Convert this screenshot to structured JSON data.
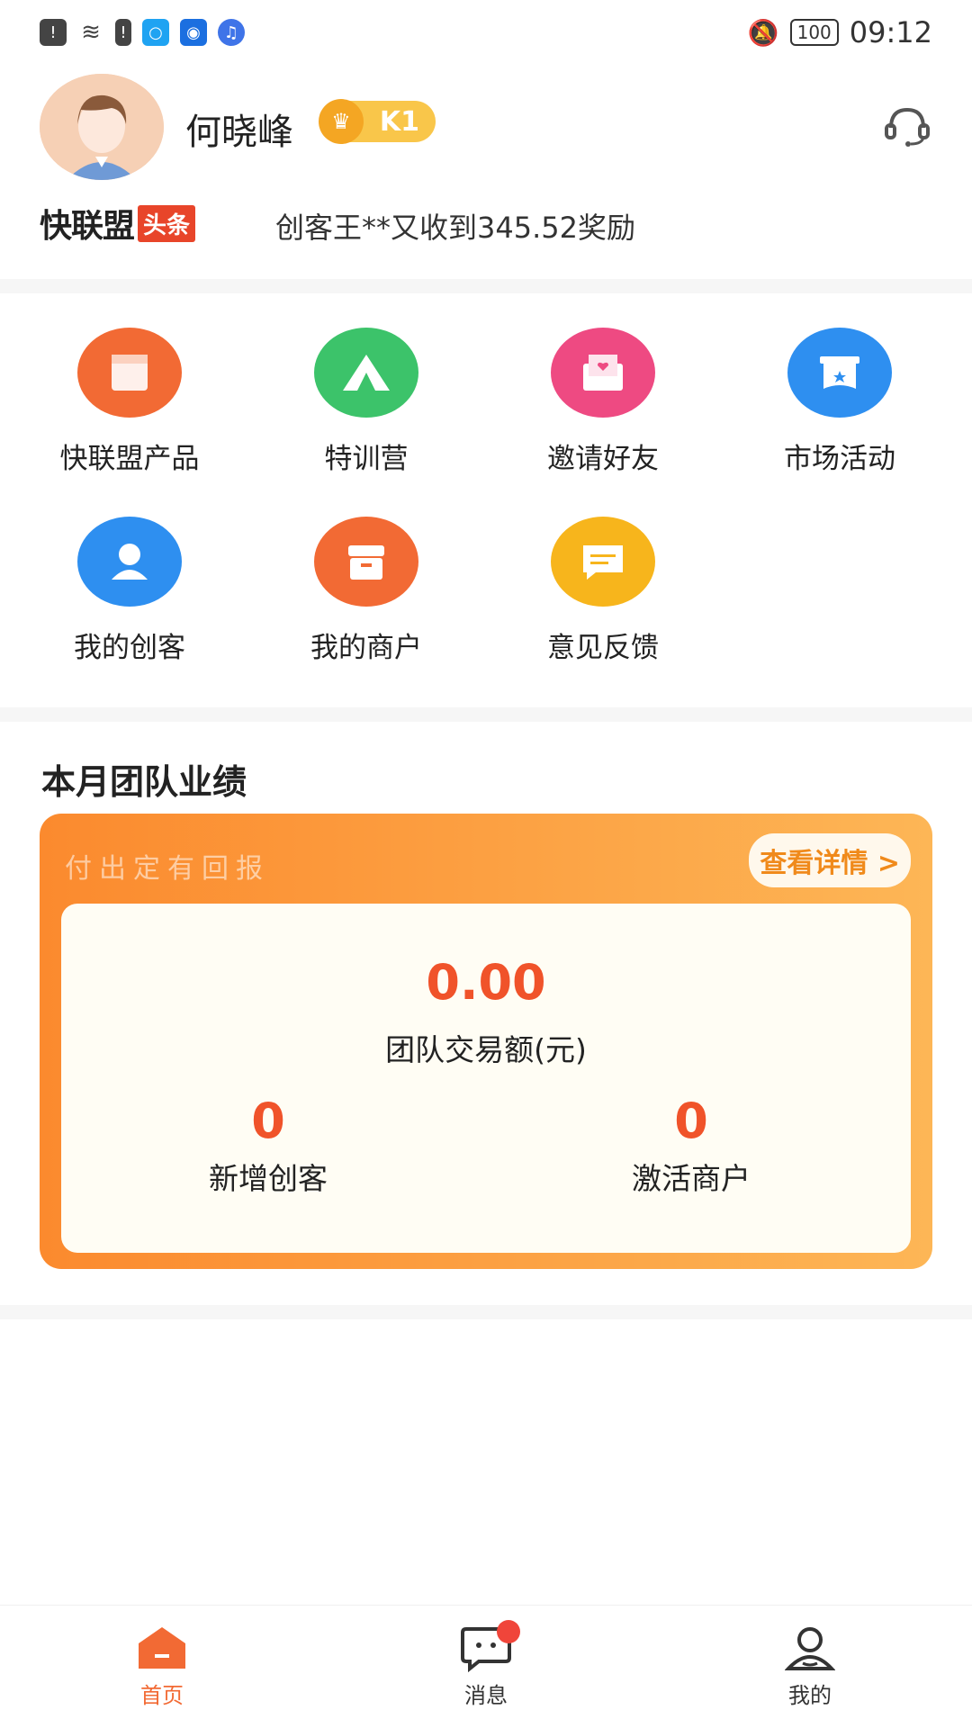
{
  "status_bar": {
    "time": "09:12",
    "battery": "100"
  },
  "profile": {
    "name": "何晓峰",
    "level": "K1"
  },
  "ticker": {
    "brand": "快联盟",
    "brand_tag": "头条",
    "message": "创客王**又收到345.52奖励"
  },
  "menu": {
    "items": [
      {
        "label": "快联盟产品",
        "icon": "product-icon",
        "color": "#f26a34"
      },
      {
        "label": "特训营",
        "icon": "camp-tent-icon",
        "color": "#3cc36a"
      },
      {
        "label": "邀请好友",
        "icon": "invite-envelope-icon",
        "color": "#ee4a82"
      },
      {
        "label": "市场活动",
        "icon": "market-activity-icon",
        "color": "#2e8ff0"
      },
      {
        "label": "我的创客",
        "icon": "user-icon",
        "color": "#2e8ff0"
      },
      {
        "label": "我的商户",
        "icon": "store-icon",
        "color": "#f26a34"
      },
      {
        "label": "意见反馈",
        "icon": "feedback-icon",
        "color": "#f7b51c"
      }
    ]
  },
  "performance": {
    "title": "本月团队业绩",
    "slogan": "付出定有回报",
    "detail_label": "查看详情 >",
    "team_amount": "0.00",
    "team_amount_label": "团队交易额(元)",
    "new_makers": "0",
    "new_makers_label": "新增创客",
    "active_merchants": "0",
    "active_merchants_label": "激活商户"
  },
  "tabbar": {
    "home": "首页",
    "messages": "消息",
    "mine": "我的",
    "accent": "#f26a34"
  }
}
